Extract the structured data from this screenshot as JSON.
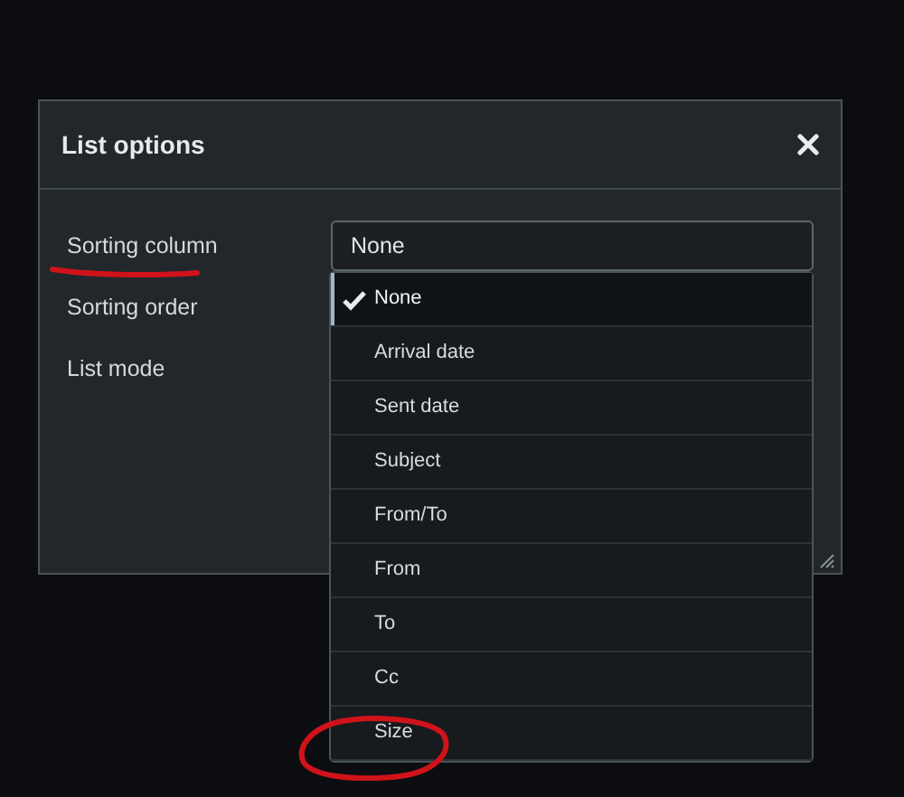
{
  "dialog": {
    "title": "List options",
    "fields": [
      {
        "label": "Sorting column",
        "value": "None",
        "underlined": true
      },
      {
        "label": "Sorting order",
        "underlined": false
      },
      {
        "label": "List mode",
        "underlined": false
      }
    ],
    "dropdown": {
      "options": [
        {
          "label": "None",
          "selected": true,
          "circled": false
        },
        {
          "label": "Arrival date",
          "selected": false,
          "circled": false
        },
        {
          "label": "Sent date",
          "selected": false,
          "circled": false
        },
        {
          "label": "Subject",
          "selected": false,
          "circled": false
        },
        {
          "label": "From/To",
          "selected": false,
          "circled": false
        },
        {
          "label": "From",
          "selected": false,
          "circled": false
        },
        {
          "label": "To",
          "selected": false,
          "circled": false
        },
        {
          "label": "Cc",
          "selected": false,
          "circled": false
        },
        {
          "label": "Size",
          "selected": false,
          "circled": true
        }
      ]
    }
  }
}
